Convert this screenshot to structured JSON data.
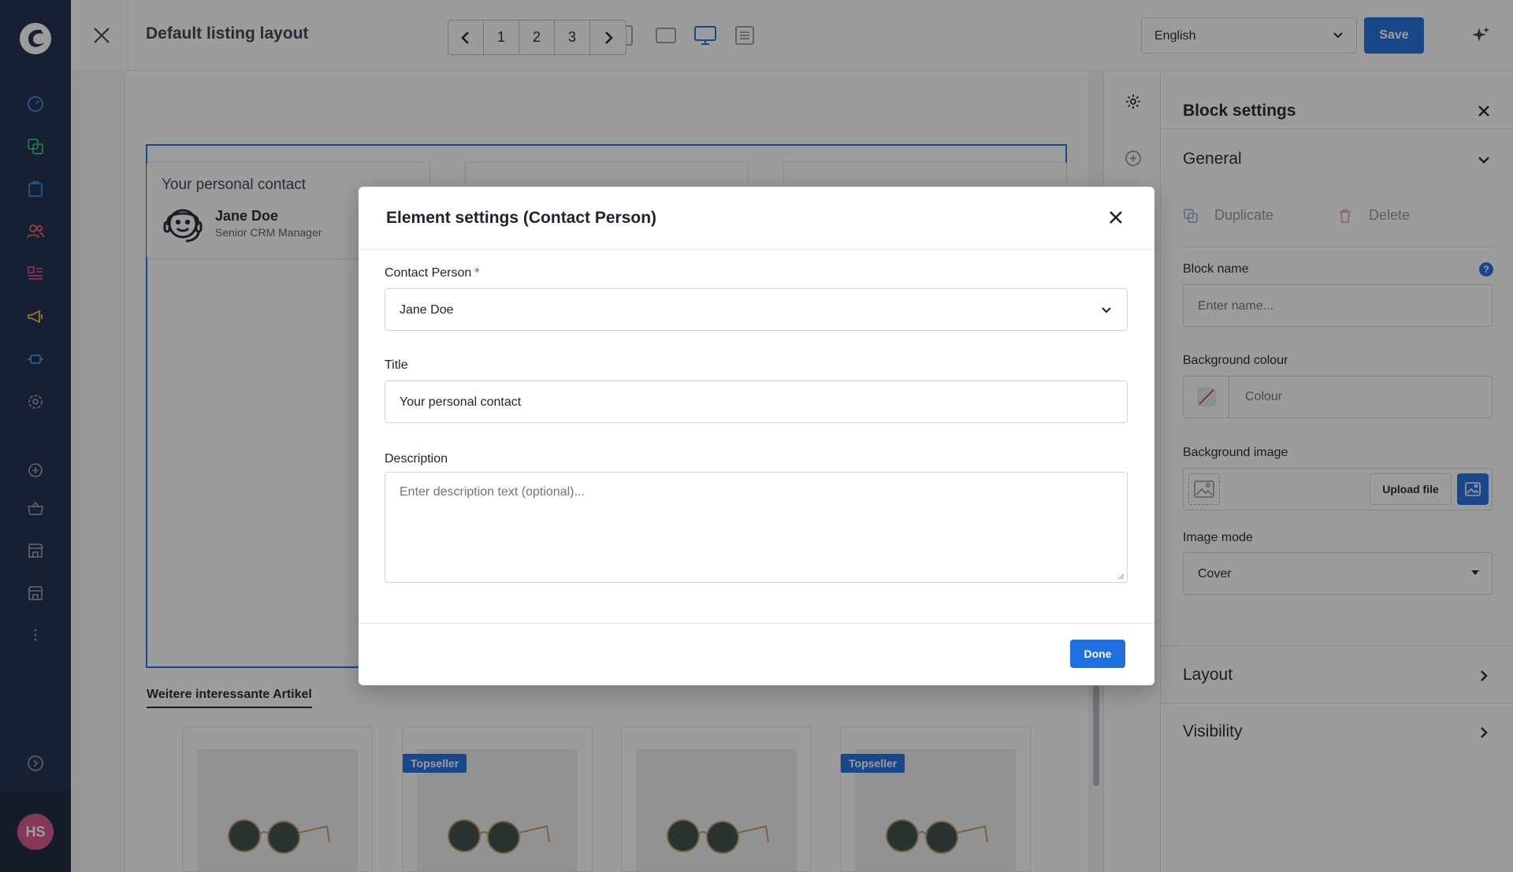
{
  "app": {
    "user_initials": "HS"
  },
  "topbar": {
    "title": "Default listing layout",
    "language": "English",
    "save_label": "Save"
  },
  "pager": {
    "pages": [
      "1",
      "2",
      "3"
    ]
  },
  "canvas": {
    "contact_card": {
      "title": "Your personal contact",
      "name": "Jane Doe",
      "role": "Senior CRM Manager"
    },
    "section_heading": "Weitere interessante Artikel",
    "badge_label": "Topseller"
  },
  "panel": {
    "title": "Block settings",
    "general": "General",
    "duplicate": "Duplicate",
    "delete": "Delete",
    "block_name_label": "Block name",
    "block_name_placeholder": "Enter name...",
    "bg_colour_label": "Background colour",
    "bg_colour_placeholder": "Colour",
    "bg_image_label": "Background image",
    "upload_label": "Upload file",
    "image_mode_label": "Image mode",
    "image_mode_value": "Cover",
    "layout": "Layout",
    "visibility": "Visibility"
  },
  "modal": {
    "title": "Element settings (Contact Person)",
    "contact_label": "Contact Person",
    "required_mark": "*",
    "contact_value": "Jane Doe",
    "title_label": "Title",
    "title_value": "Your personal contact",
    "description_label": "Description",
    "description_placeholder": "Enter description text (optional)...",
    "done_label": "Done"
  },
  "colors": {
    "accent": "#1e6fe0",
    "rail": "#1a2a4a",
    "avatar": "#d6548c"
  }
}
